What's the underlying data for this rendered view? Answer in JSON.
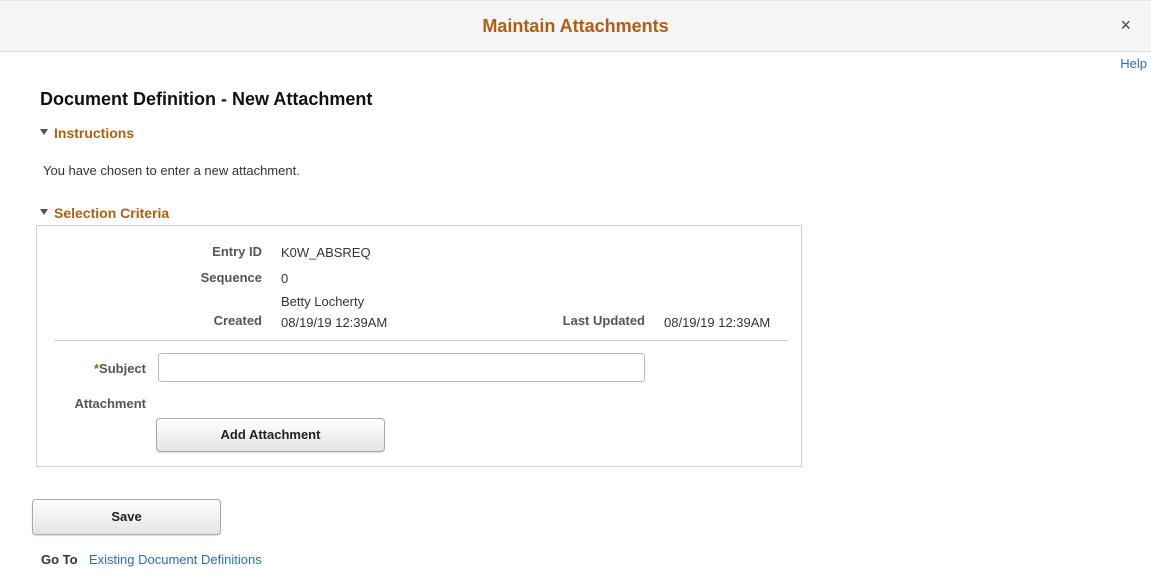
{
  "modal": {
    "title": "Maintain Attachments",
    "close_label": "×",
    "help_label": "Help"
  },
  "page": {
    "title": "Document Definition - New Attachment"
  },
  "instructions": {
    "heading": "Instructions",
    "text": "You have chosen to enter a new attachment."
  },
  "selection_criteria": {
    "heading": "Selection Criteria",
    "entry_id_label": "Entry ID",
    "entry_id_value": "K0W_ABSREQ",
    "sequence_label": "Sequence",
    "sequence_value": "0",
    "created_by": "Betty Locherty",
    "created_label": "Created",
    "created_value": "08/19/19 12:39AM",
    "last_updated_label": "Last Updated",
    "last_updated_value": "08/19/19 12:39AM",
    "subject_required_mark": "*",
    "subject_label": "Subject",
    "subject_value": "",
    "attachment_label": "Attachment",
    "add_attachment_label": "Add Attachment"
  },
  "actions": {
    "save_label": "Save"
  },
  "goto": {
    "label": "Go To",
    "link_text": "Existing Document Definitions"
  },
  "colors": {
    "accent": "#b05e12",
    "link": "#2a6ebb"
  }
}
